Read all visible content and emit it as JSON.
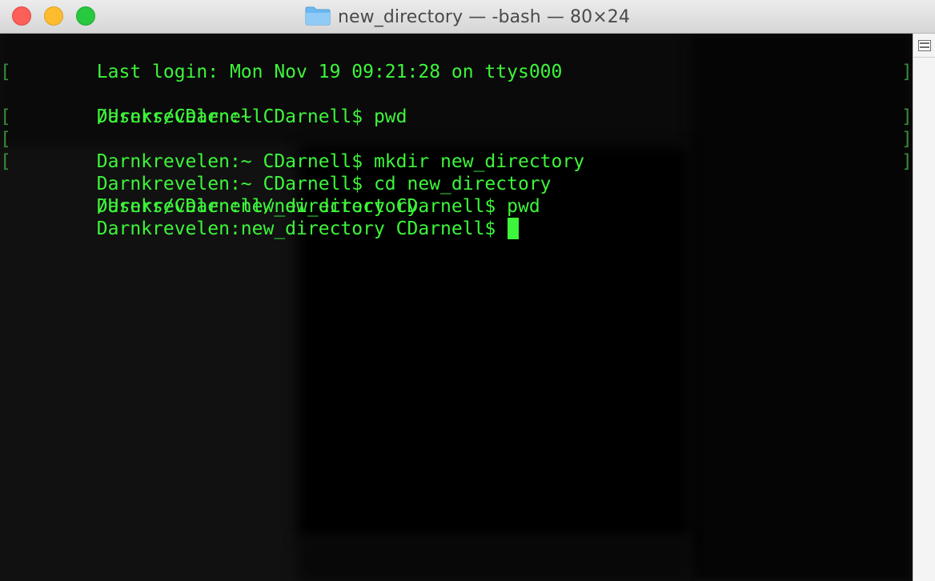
{
  "window": {
    "title": "new_directory — -bash — 80×24",
    "title_icon": "folder-icon",
    "controls": {
      "close": "close-icon",
      "minimize": "minimize-icon",
      "zoom": "zoom-icon"
    }
  },
  "terminal": {
    "foreground_color": "#3df53a",
    "background_color": "#111111",
    "lines": [
      {
        "text": "Last login: Mon Nov 19 09:21:28 on ttys000",
        "marked": false
      },
      {
        "text": "Darnkrevelen:~ CDarnell$ pwd",
        "marked": true
      },
      {
        "text": "/Users/CDarnell",
        "marked": false
      },
      {
        "text": "Darnkrevelen:~ CDarnell$ mkdir new_directory",
        "marked": true
      },
      {
        "text": "Darnkrevelen:~ CDarnell$ cd new_directory",
        "marked": true
      },
      {
        "text": "Darnkrevelen:new_directory CDarnell$ pwd",
        "marked": true
      },
      {
        "text": "/Users/CDarnell/new_directory",
        "marked": false
      }
    ],
    "prompt": "Darnkrevelen:new_directory CDarnell$ ",
    "mark_left": "[",
    "mark_right": "]"
  },
  "scrollbar": {
    "split_icon": "split-pane-icon"
  }
}
